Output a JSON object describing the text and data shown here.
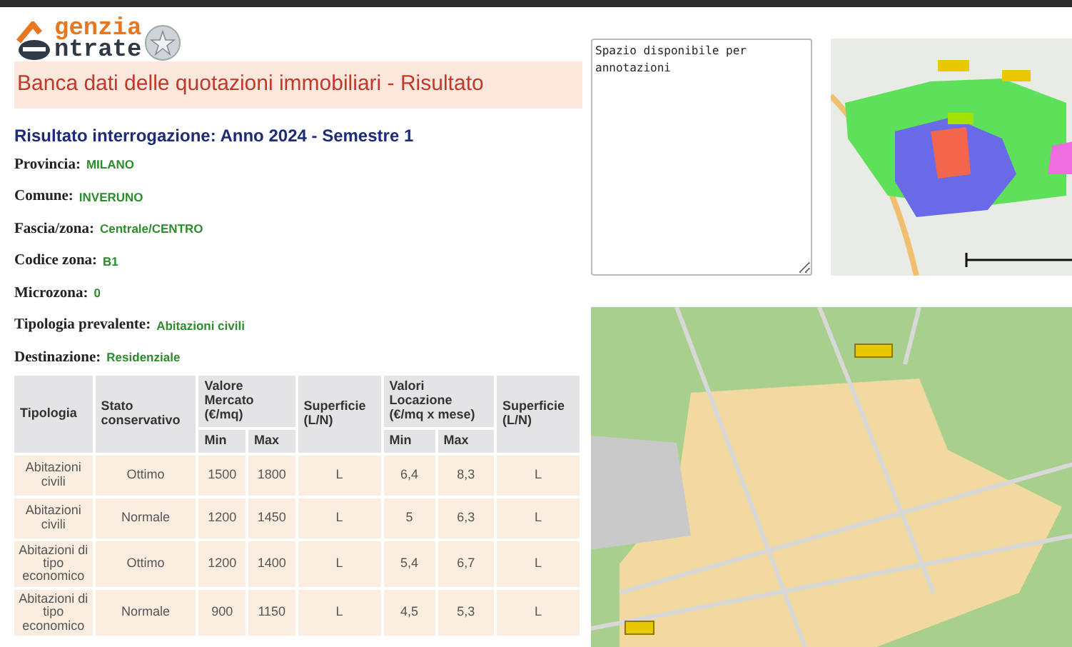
{
  "header": {
    "logo_top": "genzia",
    "logo_bottom": "ntrate",
    "title": "Banca dati delle quotazioni immobiliari - Risultato"
  },
  "result_heading": "Risultato interrogazione: Anno 2024 - Semestre 1",
  "fields": [
    {
      "label": "Provincia:",
      "value": "MILANO"
    },
    {
      "label": "Comune:",
      "value": "INVERUNO"
    },
    {
      "label": "Fascia/zona:",
      "value": "Centrale/CENTRO"
    },
    {
      "label": "Codice zona:",
      "value": "B1"
    },
    {
      "label": "Microzona:",
      "value": "0"
    },
    {
      "label": "Tipologia prevalente:",
      "value": "Abitazioni civili"
    },
    {
      "label": "Destinazione:",
      "value": "Residenziale"
    }
  ],
  "table": {
    "columns": [
      {
        "label": "Tipologia"
      },
      {
        "label": "Stato conservativo"
      },
      {
        "label": "Valore Mercato (€/mq)",
        "colspan": 2
      },
      {
        "label": "Superficie (L/N)"
      },
      {
        "label": "Valori Locazione (€/mq x mese)",
        "colspan": 2
      },
      {
        "label": "Superficie (L/N)"
      }
    ],
    "subcolumns": [
      "Min",
      "Max",
      "Min",
      "Max"
    ],
    "rows": [
      [
        "Abitazioni civili",
        "Ottimo",
        "1500",
        "1800",
        "L",
        "6,4",
        "8,3",
        "L"
      ],
      [
        "Abitazioni civili",
        "Normale",
        "1200",
        "1450",
        "L",
        "5",
        "6,3",
        "L"
      ],
      [
        "Abitazioni di tipo economico",
        "Ottimo",
        "1200",
        "1400",
        "L",
        "5,4",
        "6,7",
        "L"
      ],
      [
        "Abitazioni di tipo economico",
        "Normale",
        "900",
        "1150",
        "L",
        "4,5",
        "5,3",
        "L"
      ]
    ]
  },
  "notes": {
    "value": "Spazio disponibile per\nannotazioni"
  }
}
